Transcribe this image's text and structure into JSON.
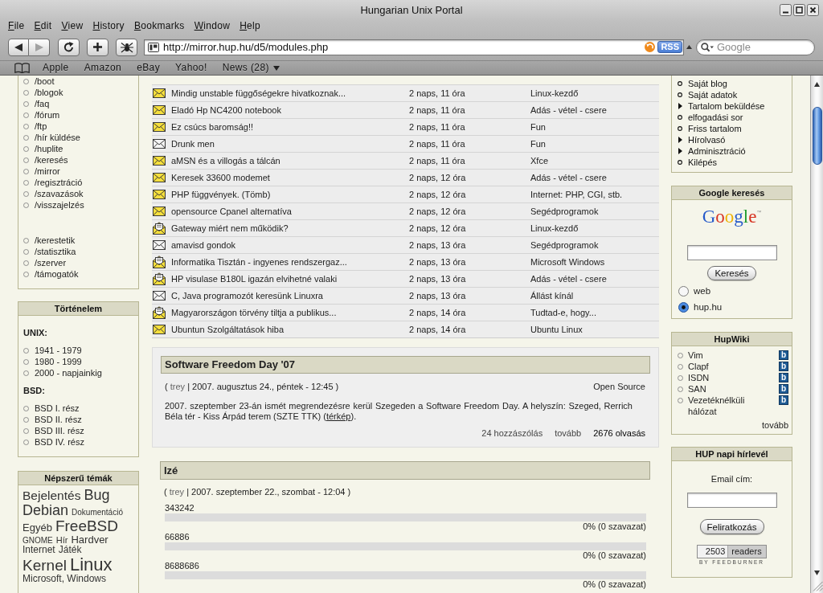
{
  "window": {
    "title": "Hungarian Unix Portal"
  },
  "menu_bar": [
    "File",
    "Edit",
    "View",
    "History",
    "Bookmarks",
    "Window",
    "Help"
  ],
  "toolbar": {
    "navigation": [
      {
        "kind": "back",
        "disabled": false
      },
      {
        "kind": "forward",
        "disabled": true
      }
    ],
    "address": "http://mirror.hup.hu/d5/modules.php",
    "feed_badge": "RSS",
    "search": {
      "placeholder": "Google"
    }
  },
  "bookmarks_bar": [
    {
      "label": "Apple",
      "kind": "link"
    },
    {
      "label": "Amazon",
      "kind": "link"
    },
    {
      "label": "eBay",
      "kind": "link"
    },
    {
      "label": "Yahoo!",
      "kind": "link"
    },
    {
      "label": "News (28)",
      "kind": "folder"
    }
  ],
  "left_sidebar": {
    "link_groups": [
      [
        "/boot",
        "/blogok",
        "/faq",
        "/fórum",
        "/ftp",
        "/hír küldése",
        "/huplite",
        "/keresés",
        "/mirror",
        "/regisztráció",
        "/szavazások",
        "/visszajelzés"
      ],
      [
        "/kerestetik",
        "/statisztika",
        "/szerver",
        "/támogatók"
      ]
    ],
    "history": {
      "title": "Történelem",
      "sections": [
        {
          "heading": "UNIX:",
          "items": [
            "1941 - 1979",
            "1980 - 1999",
            "2000 - napjainkig"
          ]
        },
        {
          "heading": "BSD:",
          "items": [
            "BSD I. rész",
            "BSD II. rész",
            "BSD III. rész",
            "BSD IV. rész"
          ]
        }
      ]
    },
    "popular_topics": {
      "title": "Népszerű témák",
      "tags": [
        {
          "label": "Bejelentés",
          "kind": "tier5"
        },
        {
          "label": "Bug",
          "kind": "tier6"
        },
        {
          "label": "Debian",
          "kind": "tier6"
        },
        {
          "label": "Dokumentáció",
          "kind": "tier1"
        },
        {
          "label": "Egyéb",
          "kind": "tier4"
        },
        {
          "label": "FreeBSD",
          "kind": "tier7"
        },
        {
          "label": "GNOME",
          "kind": "tier1"
        },
        {
          "label": "Hír",
          "kind": "tier2"
        },
        {
          "label": "Hardver",
          "kind": "tier4"
        },
        {
          "label": "Internet",
          "kind": "tier3"
        },
        {
          "label": "Játék",
          "kind": "tier3"
        },
        {
          "label": "Kernel",
          "kind": "tier7"
        },
        {
          "label": "Linux",
          "kind": "tier8"
        },
        {
          "label": "Microsoft, Windows",
          "kind": "tier3"
        }
      ]
    }
  },
  "forum_topics": [
    {
      "kind": "new",
      "title": "Mindig unstable függőségekre hivatkoznak...",
      "age": "2 naps, 11 óra",
      "category": "Linux-kezdő"
    },
    {
      "kind": "new",
      "title": "Eladó Hp NC4200 notebook",
      "age": "2 naps, 11 óra",
      "category": "Adás - vétel - csere"
    },
    {
      "kind": "new",
      "title": "Ez csúcs baromság!!",
      "age": "2 naps, 11 óra",
      "category": "Fun"
    },
    {
      "kind": "read",
      "title": "Drunk men",
      "age": "2 naps, 11 óra",
      "category": "Fun"
    },
    {
      "kind": "new",
      "title": "aMSN és a villogás a tálcán",
      "age": "2 naps, 11 óra",
      "category": "Xfce"
    },
    {
      "kind": "new",
      "title": "Keresek 33600 modemet",
      "age": "2 naps, 12 óra",
      "category": "Adás - vétel - csere"
    },
    {
      "kind": "new",
      "title": "PHP függvények. (Tömb)",
      "age": "2 naps, 12 óra",
      "category": "Internet: PHP, CGI, stb."
    },
    {
      "kind": "new",
      "title": "opensource Cpanel alternatíva",
      "age": "2 naps, 12 óra",
      "category": "Segédprogramok"
    },
    {
      "kind": "hot",
      "title": "Gateway miért nem működik?",
      "age": "2 naps, 12 óra",
      "category": "Linux-kezdő"
    },
    {
      "kind": "read",
      "title": "amavisd gondok",
      "age": "2 naps, 13 óra",
      "category": "Segédprogramok"
    },
    {
      "kind": "hot",
      "title": "Informatika Tisztán - ingyenes rendszergaz...",
      "age": "2 naps, 13 óra",
      "category": "Microsoft Windows"
    },
    {
      "kind": "hot",
      "title": "HP visulase B180L igazán elvihetné valaki",
      "age": "2 naps, 13 óra",
      "category": "Adás - vétel - csere"
    },
    {
      "kind": "read",
      "title": "C, Java programozót keresünk Linuxra",
      "age": "2 naps, 13 óra",
      "category": "Állást kínál"
    },
    {
      "kind": "hot",
      "title": "Magyarországon törvény tiltja a publikus...",
      "age": "2 naps, 14 óra",
      "category": "Tudtad-e, hogy..."
    },
    {
      "kind": "new",
      "title": "Ubuntun Szolgáltatások hiba",
      "age": "2 naps, 14 óra",
      "category": "Ubuntu Linux"
    }
  ],
  "stories": [
    {
      "kind": "article",
      "title": "Software Freedom Day '07",
      "meta": [
        "( ",
        {
          "link": "trey"
        },
        " | 2007. augusztus 24., péntek - 12:45 )"
      ],
      "category": "Open Source",
      "body": [
        "2007. szeptember 23-án ismét megrendezésre kerül Szegeden a Software Freedom Day. A helyszín: Szeged, Rerrich Béla tér - Kiss Árpád terem (SZTE TTK) (",
        {
          "link": "térkép"
        },
        ")."
      ],
      "footer": [
        {
          "label": "24 hozzászólás",
          "kind": "link"
        },
        {
          "label": "tovább",
          "kind": "link"
        },
        {
          "label": "2676 olvasás",
          "kind": "stat"
        }
      ]
    },
    {
      "kind": "poll",
      "title": "Izé",
      "meta": [
        "( ",
        {
          "link": "trey"
        },
        " | 2007. szeptember 22., szombat - 12:04 )"
      ],
      "options": [
        {
          "label": "343242",
          "level": 0,
          "result": "0% (0 szavazat)"
        },
        {
          "label": "66886",
          "level": 0,
          "result": "0% (0 szavazat)"
        },
        {
          "label": "8688686",
          "level": 0,
          "result": "0% (0 szavazat)"
        }
      ]
    }
  ],
  "right_sidebar": {
    "user_menu": [
      {
        "label": "Saját blog",
        "kind": "leaf"
      },
      {
        "label": "Saját adatok",
        "kind": "leaf"
      },
      {
        "label": "Tartalom beküldése",
        "kind": "branch"
      },
      {
        "label": "elfogadási sor",
        "kind": "leaf"
      },
      {
        "label": "Friss tartalom",
        "kind": "leaf"
      },
      {
        "label": "Hírolvasó",
        "kind": "branch"
      },
      {
        "label": "Adminisztráció",
        "kind": "branch"
      },
      {
        "label": "Kilépés",
        "kind": "leaf"
      }
    ],
    "google_search": {
      "title": "Google keresés",
      "logo": "Google$^{™}$",
      "button": "Keresés",
      "scopes": [
        {
          "label": "web",
          "selected": false
        },
        {
          "label": "hup.hu",
          "selected": true
        }
      ]
    },
    "hupwiki": {
      "title": "HupWiki",
      "items": [
        {
          "label": "Vim",
          "badge": "b"
        },
        {
          "label": "Clapf",
          "badge": "b"
        },
        {
          "label": "ISDN",
          "badge": "b"
        },
        {
          "label": "SAN",
          "badge": "b"
        },
        {
          "label": "Vezetéknélküli hálózat",
          "badge": "b"
        }
      ],
      "more": "tovább"
    },
    "newsletter": {
      "title": "HUP napi hírlevél",
      "field_label": "Email cím:",
      "button": "Feliratkozás",
      "counter": {
        "count": "2503",
        "unit": "readers",
        "credit": "BY FEEDBURNER"
      }
    }
  }
}
